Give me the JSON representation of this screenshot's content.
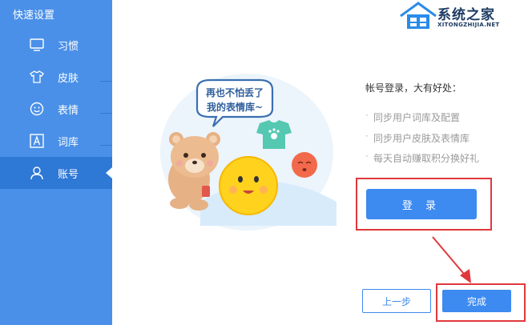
{
  "sidebar": {
    "title": "快速设置",
    "items": [
      {
        "label": "习惯",
        "icon": "monitor-icon"
      },
      {
        "label": "皮肤",
        "icon": "tshirt-icon"
      },
      {
        "label": "表情",
        "icon": "smiley-icon"
      },
      {
        "label": "词库",
        "icon": "letter-a-icon"
      },
      {
        "label": "账号",
        "icon": "user-icon",
        "active": true
      }
    ]
  },
  "brand": {
    "name": "系统之家",
    "domain": "XITONGZHIJIA.NET"
  },
  "illustration": {
    "bubble_line1": "再也不怕丢了",
    "bubble_line2": "我的表情库~"
  },
  "benefits": {
    "heading": "帐号登录，大有好处：",
    "items": [
      "同步用户词库及配置",
      "同步用户皮肤及表情库",
      "每天自动赚取积分换好礼"
    ]
  },
  "buttons": {
    "login": "登 录",
    "prev": "上一步",
    "done": "完成"
  },
  "colors": {
    "sidebar": "#4a90e8",
    "sidebar_active": "#2e78d6",
    "primary": "#3d8af0",
    "highlight": "#e0383c"
  }
}
